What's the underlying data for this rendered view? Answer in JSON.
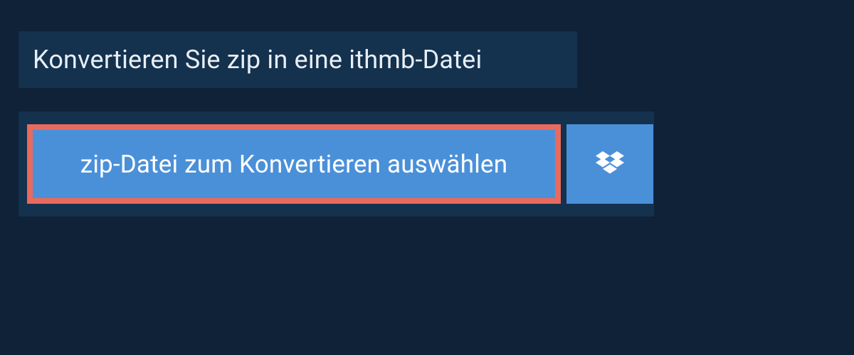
{
  "header": {
    "title": "Konvertieren Sie zip in eine ithmb-Datei"
  },
  "actions": {
    "select_file_label": "zip-Datei zum Konvertieren auswählen"
  },
  "colors": {
    "background": "#0f2238",
    "panel": "#14314e",
    "button": "#4a90d9",
    "button_border": "#e86a5e",
    "text_light": "#e8eef4",
    "text_white": "#ffffff"
  }
}
